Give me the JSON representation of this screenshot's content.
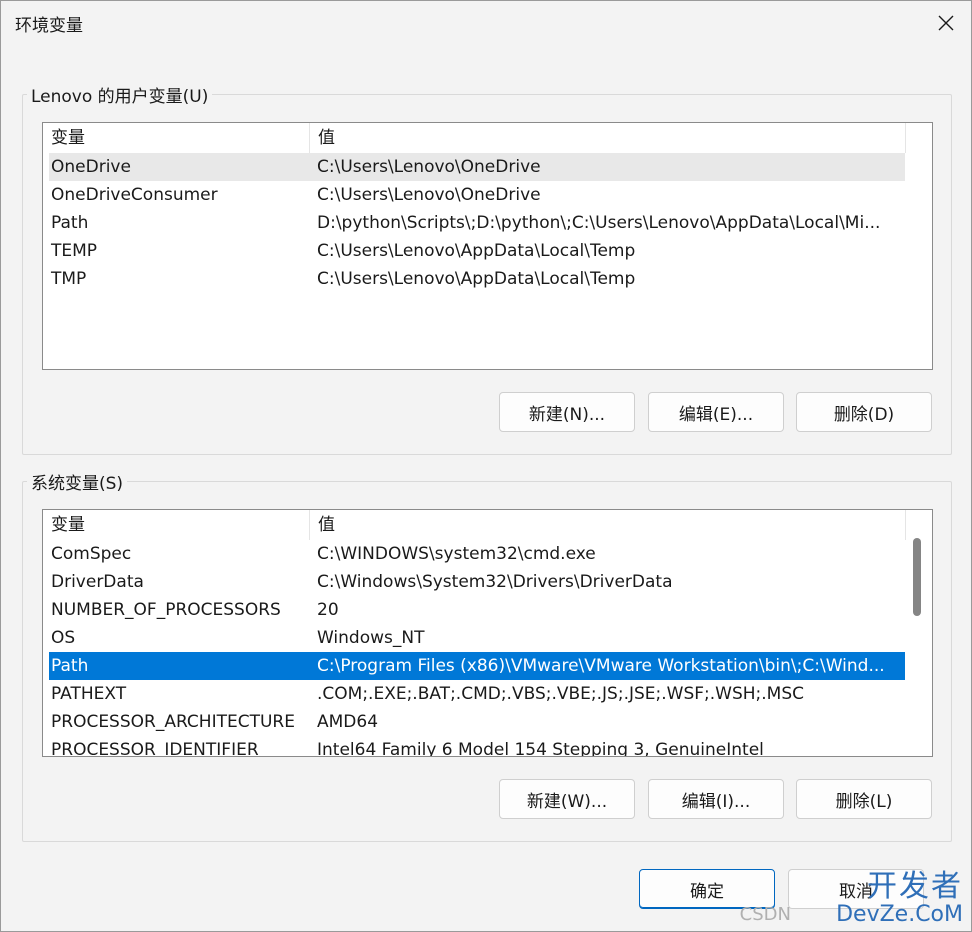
{
  "window": {
    "title": "环境变量",
    "close_icon": "close-icon"
  },
  "user_vars": {
    "label": "Lenovo 的用户变量(U)",
    "columns": [
      "变量",
      "值"
    ],
    "rows": [
      {
        "name": "OneDrive",
        "value": "C:\\Users\\Lenovo\\OneDrive"
      },
      {
        "name": "OneDriveConsumer",
        "value": "C:\\Users\\Lenovo\\OneDrive"
      },
      {
        "name": "Path",
        "value": "D:\\python\\Scripts\\;D:\\python\\;C:\\Users\\Lenovo\\AppData\\Local\\Mi..."
      },
      {
        "name": "TEMP",
        "value": "C:\\Users\\Lenovo\\AppData\\Local\\Temp"
      },
      {
        "name": "TMP",
        "value": "C:\\Users\\Lenovo\\AppData\\Local\\Temp"
      }
    ],
    "buttons": {
      "new": "新建(N)...",
      "edit": "编辑(E)...",
      "delete": "删除(D)"
    }
  },
  "system_vars": {
    "label": "系统变量(S)",
    "columns": [
      "变量",
      "值"
    ],
    "rows": [
      {
        "name": "ComSpec",
        "value": "C:\\WINDOWS\\system32\\cmd.exe"
      },
      {
        "name": "DriverData",
        "value": "C:\\Windows\\System32\\Drivers\\DriverData"
      },
      {
        "name": "NUMBER_OF_PROCESSORS",
        "value": "20"
      },
      {
        "name": "OS",
        "value": "Windows_NT"
      },
      {
        "name": "Path",
        "value": "C:\\Program Files (x86)\\VMware\\VMware Workstation\\bin\\;C:\\Wind..."
      },
      {
        "name": "PATHEXT",
        "value": ".COM;.EXE;.BAT;.CMD;.VBS;.VBE;.JS;.JSE;.WSF;.WSH;.MSC"
      },
      {
        "name": "PROCESSOR_ARCHITECTURE",
        "value": "AMD64"
      },
      {
        "name": "PROCESSOR_IDENTIFIER",
        "value": "Intel64 Family 6 Model 154 Stepping 3, GenuineIntel"
      }
    ],
    "selected_row": "Path",
    "buttons": {
      "new": "新建(W)...",
      "edit": "编辑(I)...",
      "delete": "删除(L)"
    }
  },
  "footer": {
    "ok": "确定",
    "cancel": "取消"
  },
  "watermark": {
    "main": "开发者",
    "sub": "DevZe.CoM",
    "csdn": "CSDN"
  },
  "colors": {
    "selection": "#0078d7",
    "hover_row": "#e8e8e8",
    "primary_border": "#0067c0"
  }
}
